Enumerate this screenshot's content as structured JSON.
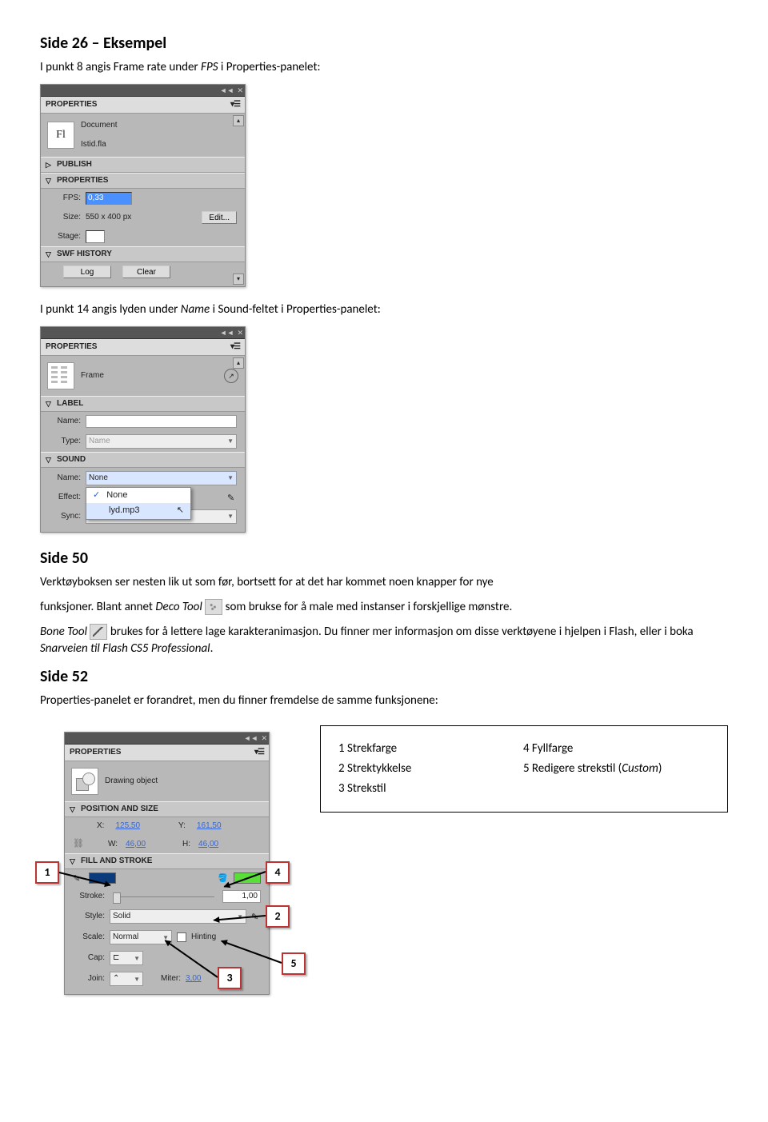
{
  "heading1": "Side 26 – Eksempel",
  "para1_a": "I punkt 8 angis Frame rate under ",
  "para1_b": "FPS",
  "para1_c": " i Properties-panelet:",
  "panel1": {
    "title": "PROPERTIES",
    "docLabel": "Document",
    "docName": "Istid.fla",
    "flLabel": "Fl",
    "sec_publish": "PUBLISH",
    "sec_properties": "PROPERTIES",
    "fps_label": "FPS:",
    "fps_value": "0,33",
    "size_label": "Size:",
    "size_value": "550 x 400 px",
    "edit_btn": "Edit...",
    "stage_label": "Stage:",
    "sec_swf": "SWF HISTORY",
    "log_btn": "Log",
    "clear_btn": "Clear"
  },
  "para2_a": "I punkt 14 angis lyden under ",
  "para2_b": "Name",
  "para2_c": " i Sound-feltet i Properties-panelet:",
  "panel2": {
    "title": "PROPERTIES",
    "frameLabel": "Frame",
    "sec_label": "LABEL",
    "name_label": "Name:",
    "type_label": "Type:",
    "type_value": "Name",
    "sec_sound": "SOUND",
    "s_name_label": "Name:",
    "s_name_value": "None",
    "effect_label": "Effect:",
    "sync_label": "Sync:",
    "opt1": "None",
    "opt2": "lyd.mp3"
  },
  "heading2": "Side 50",
  "para3": "Verktøyboksen ser nesten lik ut som før, bortsett for at det har kommet noen knapper for nye ",
  "para4_a": "funksjoner. Blant annet ",
  "para4_b": "Deco Tool",
  "para4_c": "  som brukse for å male med instanser i forskjellige mønstre.",
  "para5_a": "Bone Tool",
  "para5_b": "  brukes for å lettere lage karakteranimasjon. Du finner mer informasjon om disse verktøyene i hjelpen i Flash, eller i boka  ",
  "para5_c": "Snarveien til Flash CS5 Professional",
  "para5_d": ".",
  "heading3": "Side 52",
  "para6": "Properties-panelet er forandret, men du finner fremdelse de samme funksjonene:",
  "panel3": {
    "title": "PROPERTIES",
    "objtype": "Drawing object",
    "sec_pos": "POSITION AND SIZE",
    "x_label": "X:",
    "x_val": "125,50",
    "y_label": "Y:",
    "161,50": "161,50",
    "y_val": "161,50",
    "w_label": "W:",
    "w_val": "46,00",
    "h_label": "H:",
    "h_val": "46,00",
    "sec_fill": "FILL AND STROKE",
    "stroke_label": "Stroke:",
    "stroke_val": "1,00",
    "style_label": "Style:",
    "style_val": "Solid",
    "scale_label": "Scale:",
    "scale_val": "Normal",
    "hinting_label": "Hinting",
    "cap_label": "Cap:",
    "join_label": "Join:",
    "miter_label": "Miter:",
    "miter_val": "3,00"
  },
  "legend": {
    "l1": "1 Strekfarge",
    "l2": "2 Strektykkelse",
    "l3": "3 Strekstil",
    "r1": "4 Fyllfarge",
    "r2_a": "5 Redigere strekstil (",
    "r2_b": "Custom",
    "r2_c": ")"
  },
  "callouts": {
    "c1": "1",
    "c2": "2",
    "c3": "3",
    "c4": "4",
    "c5": "5"
  }
}
